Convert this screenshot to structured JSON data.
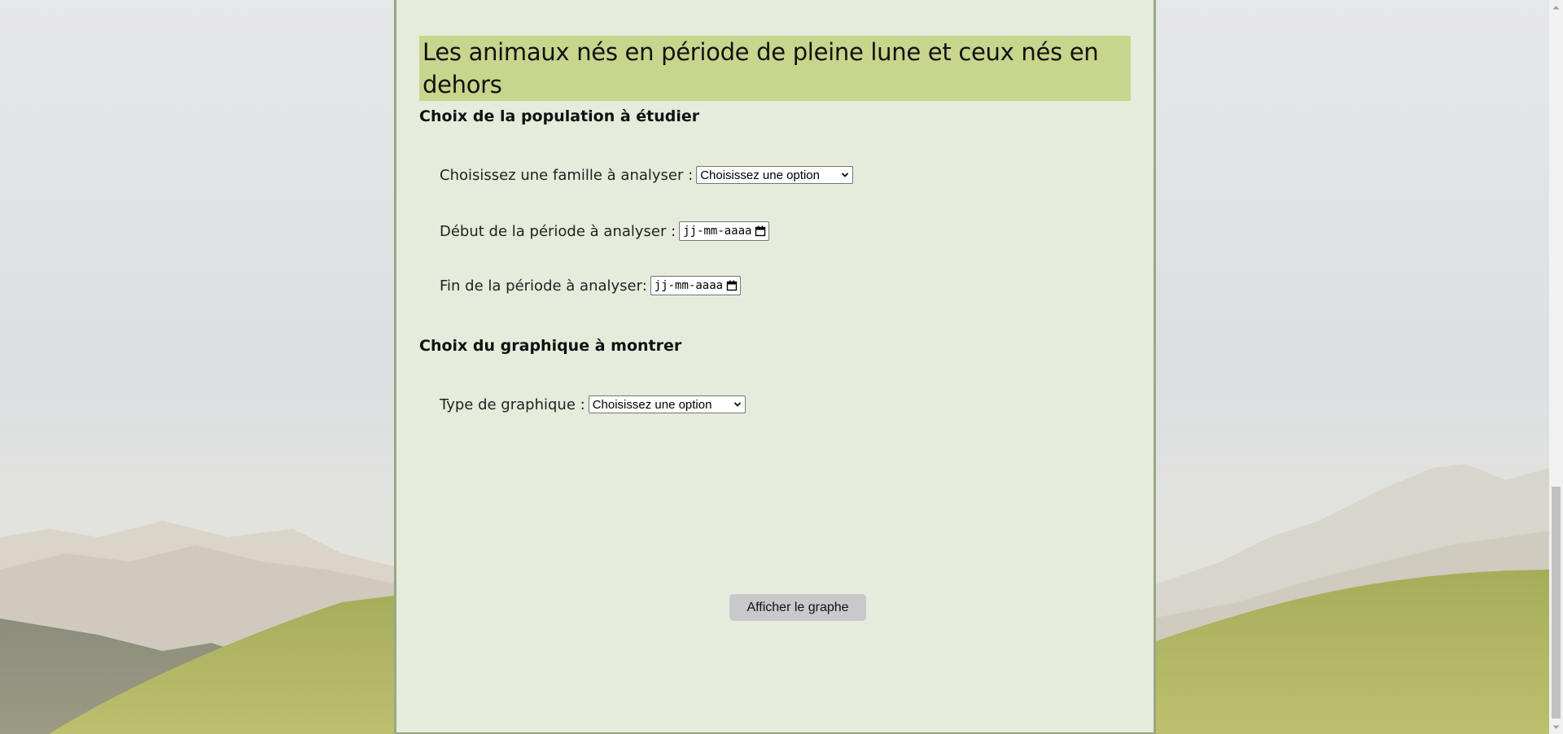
{
  "page": {
    "title": "Les animaux nés en période de pleine lune et ceux nés en dehors"
  },
  "population_section": {
    "heading": "Choix de la population à étudier",
    "family": {
      "label": "Choisissez une famille à analyser :",
      "selected": "Choisissez une option"
    },
    "start_date": {
      "label": "Début de la période à analyser :",
      "placeholder": "jj-mm-aaaa"
    },
    "end_date": {
      "label": "Fin de la période à analyser:",
      "placeholder": "jj-mm-aaaa"
    }
  },
  "graph_section": {
    "heading": "Choix du graphique à montrer",
    "type": {
      "label": "Type de graphique :",
      "selected": "Choisissez une option"
    }
  },
  "actions": {
    "show_graph_label": "Afficher le graphe"
  },
  "icons": {
    "select_chevron": "chevron-down-icon",
    "date_picker": "calendar-icon",
    "scroll_up": "scroll-up-arrow-icon",
    "scroll_down": "scroll-down-arrow-icon"
  },
  "colors": {
    "panel_background": "#e5ecdc",
    "title_highlight": "#c8d58d",
    "button_background": "#c9c9cb",
    "panel_border": "#9aa784"
  }
}
